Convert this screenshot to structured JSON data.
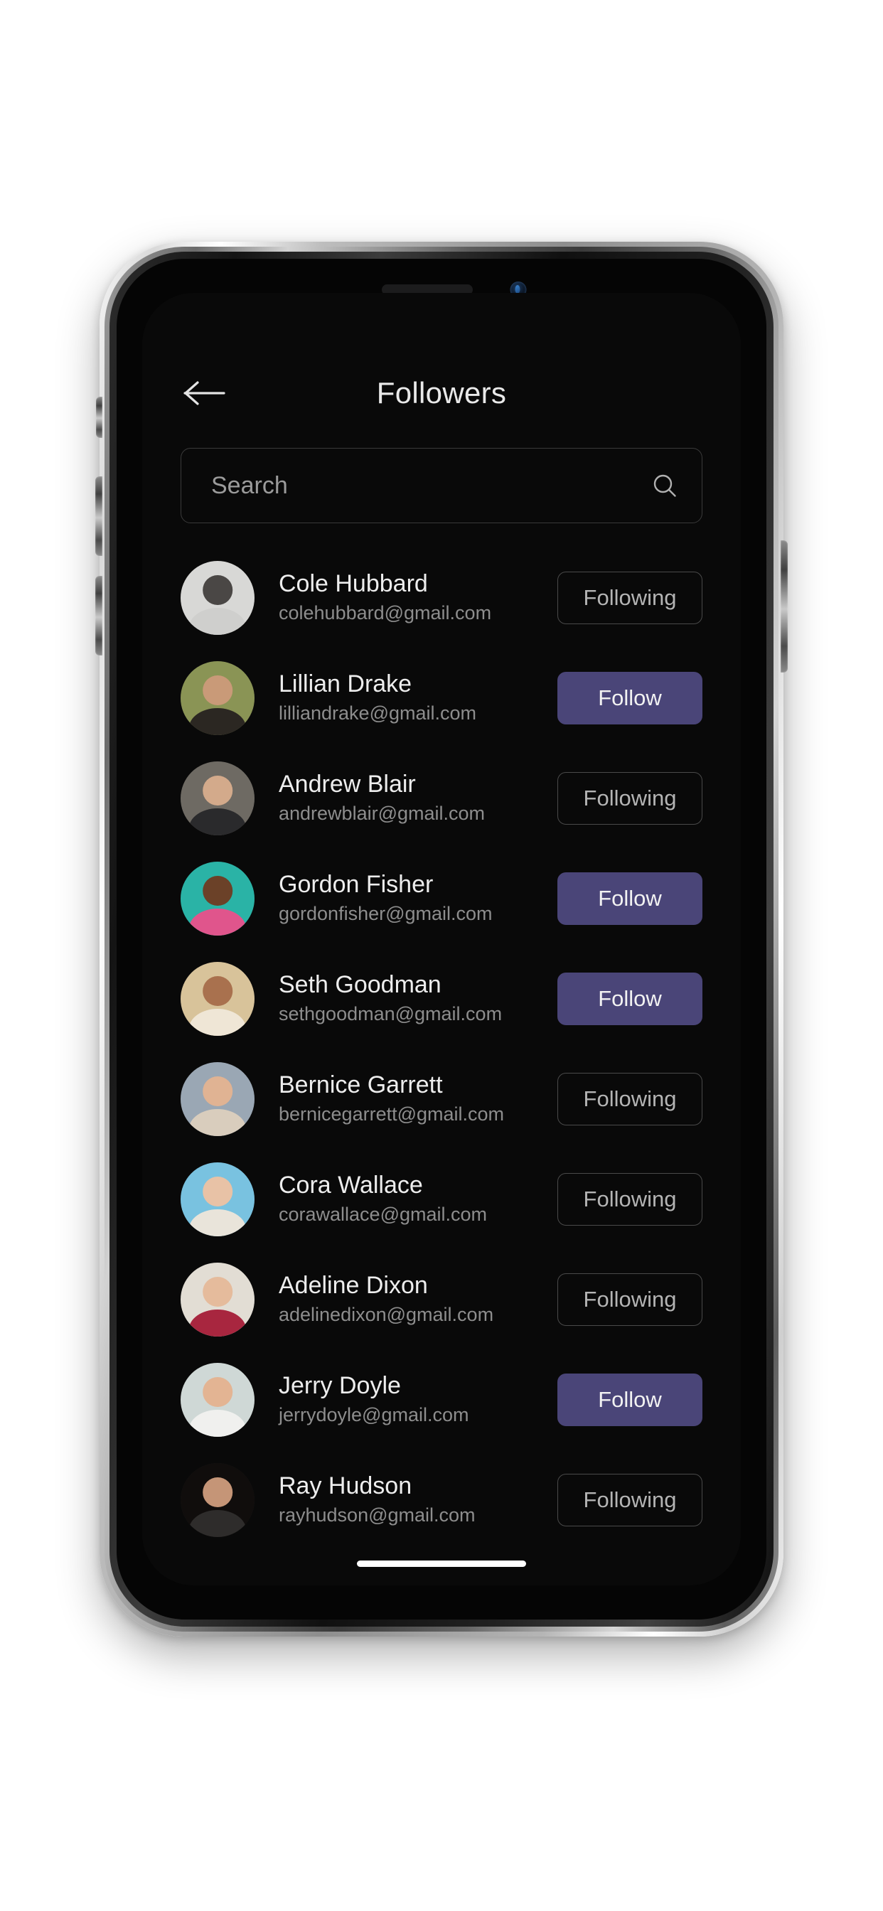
{
  "app": {
    "header": {
      "back_icon": "arrow-left-icon",
      "title": "Followers"
    },
    "search": {
      "placeholder": "Search",
      "value": "",
      "icon": "search-icon"
    },
    "buttons": {
      "follow_label": "Follow",
      "following_label": "Following"
    },
    "colors": {
      "screen_background": "#090909",
      "follow_button_fill": "#4a4578",
      "following_button_border": "#4a4a4a",
      "name_text": "#ededed",
      "email_text": "#8d8d8d",
      "title_text": "#e9e9e9",
      "placeholder_text": "#9b9b9b",
      "home_indicator": "#ffffff"
    },
    "followers": [
      {
        "name": "Cole Hubbard",
        "email": "colehubbard@gmail.com",
        "action": "Following",
        "state": "following",
        "avatar": {
          "bg": "#d8d8d6",
          "skin": "#4a4745",
          "body": "#cfcfcd"
        }
      },
      {
        "name": "Lillian Drake",
        "email": "lilliandrake@gmail.com",
        "action": "Follow",
        "state": "follow",
        "avatar": {
          "bg": "#8a9455",
          "skin": "#c99a78",
          "body": "#2b2722"
        }
      },
      {
        "name": "Andrew Blair",
        "email": "andrewblair@gmail.com",
        "action": "Following",
        "state": "following",
        "avatar": {
          "bg": "#6e6a63",
          "skin": "#d3aa8b",
          "body": "#2a2a2c"
        }
      },
      {
        "name": "Gordon Fisher",
        "email": "gordonfisher@gmail.com",
        "action": "Follow",
        "state": "follow",
        "avatar": {
          "bg": "#2ab3a6",
          "skin": "#6b4128",
          "body": "#e0558c"
        }
      },
      {
        "name": "Seth Goodman",
        "email": "sethgoodman@gmail.com",
        "action": "Follow",
        "state": "follow",
        "avatar": {
          "bg": "#d8c39a",
          "skin": "#a9714e",
          "body": "#efe6d6"
        }
      },
      {
        "name": "Bernice Garrett",
        "email": "bernicegarrett@gmail.com",
        "action": "Following",
        "state": "following",
        "avatar": {
          "bg": "#9aa7b4",
          "skin": "#e0b393",
          "body": "#d9cdbd"
        }
      },
      {
        "name": "Cora Wallace",
        "email": "corawallace@gmail.com",
        "action": "Following",
        "state": "following",
        "avatar": {
          "bg": "#79c2e0",
          "skin": "#e8c2a6",
          "body": "#e9e4da"
        }
      },
      {
        "name": "Adeline Dixon",
        "email": "adelinedixon@gmail.com",
        "action": "Following",
        "state": "following",
        "avatar": {
          "bg": "#e2ddd4",
          "skin": "#e5bb9c",
          "body": "#a8263f"
        }
      },
      {
        "name": "Jerry Doyle",
        "email": "jerrydoyle@gmail.com",
        "action": "Follow",
        "state": "follow",
        "avatar": {
          "bg": "#cfd8d6",
          "skin": "#e3b493",
          "body": "#f0f0ee"
        }
      },
      {
        "name": "Ray Hudson",
        "email": "rayhudson@gmail.com",
        "action": "Following",
        "state": "following",
        "avatar": {
          "bg": "#100d0c",
          "skin": "#c59577",
          "body": "#2e2c2b"
        }
      }
    ]
  }
}
